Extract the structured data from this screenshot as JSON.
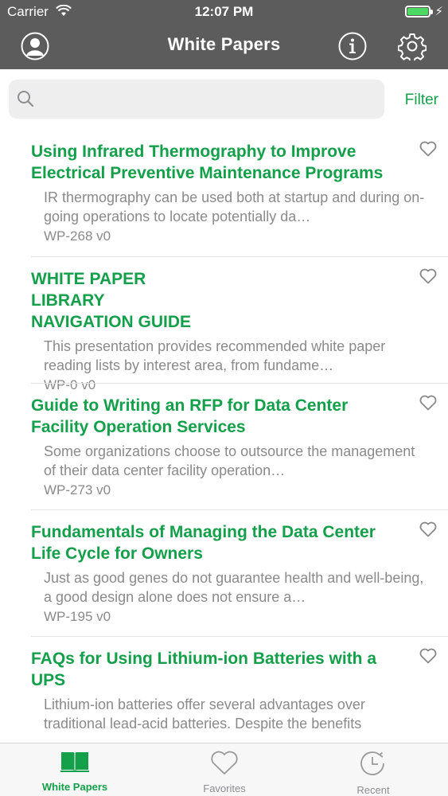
{
  "status_bar": {
    "carrier": "Carrier",
    "time": "12:07 PM",
    "wifi_icon": "wifi-icon",
    "battery_icon": "battery-icon"
  },
  "header": {
    "title": "White Papers",
    "left_icon": "user-avatar-icon",
    "right_icons": [
      "info-icon",
      "gear-icon"
    ]
  },
  "search": {
    "placeholder": "",
    "value": "",
    "filter_label": "Filter"
  },
  "papers": [
    {
      "title": "Using Infrared Thermography to Improve Electrical Preventive Maintenance Programs",
      "description": "IR thermography can be used both at startup and during on-going operations to locate potentially da…",
      "id": "WP-268 v0"
    },
    {
      "title": "WHITE PAPER LIBRARY NAVIGATION GUIDE",
      "description": "This presentation provides recommended white paper reading lists by interest area, from fundame…",
      "id": "WP-0 v0"
    },
    {
      "title": "Guide to Writing an RFP for Data Center Facility Operation Services",
      "description": "Some organizations choose to outsource the management of their data center facility operation…",
      "id": "WP-273 v0"
    },
    {
      "title": "Fundamentals of Managing the Data Center Life Cycle for Owners",
      "description": "Just as good genes do not guarantee health and well-being, a good design alone does not ensure a…",
      "id": "WP-195 v0"
    },
    {
      "title": "FAQs for Using Lithium-ion Batteries with a UPS",
      "description": "Lithium-ion batteries offer several advantages over traditional lead-acid batteries. Despite the benefits",
      "id": ""
    }
  ],
  "tabs": [
    {
      "label": "White Papers",
      "icon": "book-icon",
      "active": true
    },
    {
      "label": "Favorites",
      "icon": "heart-icon",
      "active": false
    },
    {
      "label": "Recent",
      "icon": "clock-icon",
      "active": false
    }
  ],
  "colors": {
    "accent": "#14a04a",
    "header_bg": "#5c5c5c",
    "muted_text": "#8a8a8a"
  }
}
